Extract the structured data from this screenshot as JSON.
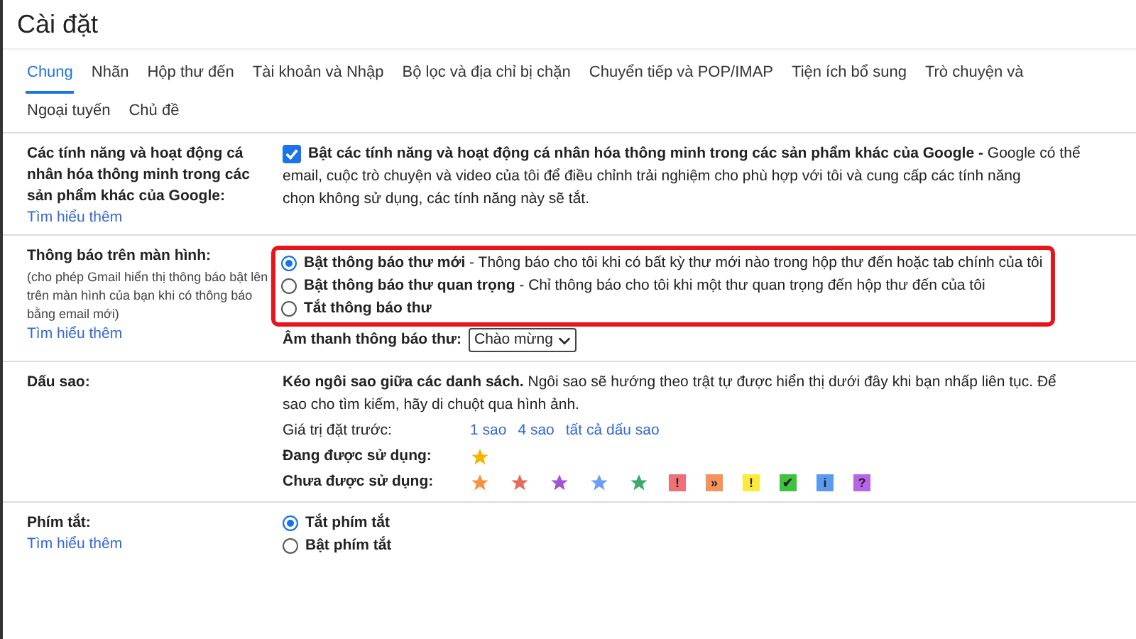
{
  "window": {
    "title": "Cài đặt"
  },
  "tabs": [
    {
      "label": "Chung",
      "selected": true
    },
    {
      "label": "Nhãn",
      "selected": false
    },
    {
      "label": "Hộp thư đến",
      "selected": false
    },
    {
      "label": "Tài khoản và Nhập",
      "selected": false
    },
    {
      "label": "Bộ lọc và địa chỉ bị chặn",
      "selected": false
    },
    {
      "label": "Chuyển tiếp và POP/IMAP",
      "selected": false
    },
    {
      "label": "Tiện ích bổ sung",
      "selected": false
    },
    {
      "label": "Trò chuyện và",
      "selected": false
    },
    {
      "label": "Ngoại tuyến",
      "selected": false
    },
    {
      "label": "Chủ đề",
      "selected": false
    }
  ],
  "smart_features": {
    "label": "Các tính năng và hoạt động cá nhân hóa thông minh trong các sản phẩm khác của Google:",
    "link": "Tìm hiểu thêm",
    "checked": true,
    "text": "**Bật các tính năng và hoạt động cá nhân hóa thông minh trong các sản phẩm khác của Google -** Google có thể",
    "text_lines": [
      "email, cuộc trò chuyện và video của tôi để điều chỉnh trải nghiệm cho phù hợp với tôi và cung cấp các tính năng",
      "chọn không sử dụng, các tính năng này sẽ tắt."
    ]
  },
  "desktop_notifications": {
    "label": "Thông báo trên màn hình:",
    "hint": "(cho phép Gmail hiển thị thông báo bật lên trên màn hình của bạn khi có thông báo bằng email mới)",
    "link": "Tìm hiểu thêm",
    "options": [
      {
        "title": "Bật thông báo thư mới",
        "desc": " - Thông báo cho tôi khi có bất kỳ thư mới nào trong hộp thư đến hoặc tab chính của tôi",
        "selected": true
      },
      {
        "title": "Bật thông báo thư quan trọng",
        "desc": " - Chỉ thông báo cho tôi khi một thư quan trọng đến hộp thư đến của tôi",
        "selected": false
      },
      {
        "title": "Tắt thông báo thư",
        "selected": false
      }
    ],
    "sound_label": "Âm thanh thông báo thư:",
    "sound_value": "Chào mừng"
  },
  "stars": {
    "label": "Dấu sao:",
    "text": "**Kéo ngôi sao giữa các danh sách.**  Ngôi sao sẽ hướng theo trật tự được hiển thị dưới đây khi bạn nhấp liên tục. Để",
    "text_line2": "sao cho tìm kiếm, hãy di chuột qua hình ảnh.",
    "presets_label": "Giá trị đặt trước:",
    "presets": [
      "1 sao",
      "4 sao",
      "tất cả dấu sao"
    ],
    "in_use_label": "Đang được sử dụng:",
    "in_use": [
      {
        "kind": "star",
        "color": "#f4b400"
      }
    ],
    "not_in_use_label": "Chưa được sử dụng:",
    "not_in_use": [
      {
        "kind": "star",
        "color": "#f6913f"
      },
      {
        "kind": "star",
        "color": "#e36c5c"
      },
      {
        "kind": "star",
        "color": "#a254d1"
      },
      {
        "kind": "star",
        "color": "#6b9ff5"
      },
      {
        "kind": "star",
        "color": "#3fa969"
      },
      {
        "kind": "box",
        "color": "#f0707a",
        "glyph": "!"
      },
      {
        "kind": "box",
        "color": "#f5935a",
        "glyph": "»"
      },
      {
        "kind": "box",
        "color": "#fbea3c",
        "glyph": "!"
      },
      {
        "kind": "box",
        "color": "#3dc33d",
        "glyph": "✔"
      },
      {
        "kind": "box",
        "color": "#5a9bef",
        "glyph": "i"
      },
      {
        "kind": "box",
        "color": "#b565e6",
        "glyph": "?"
      }
    ]
  },
  "shortcuts": {
    "label": "Phím tắt:",
    "link": "Tìm hiểu thêm",
    "options": [
      {
        "title": "Tắt phím tắt",
        "selected": true
      },
      {
        "title": "Bật phím tắt",
        "selected": false
      }
    ]
  }
}
